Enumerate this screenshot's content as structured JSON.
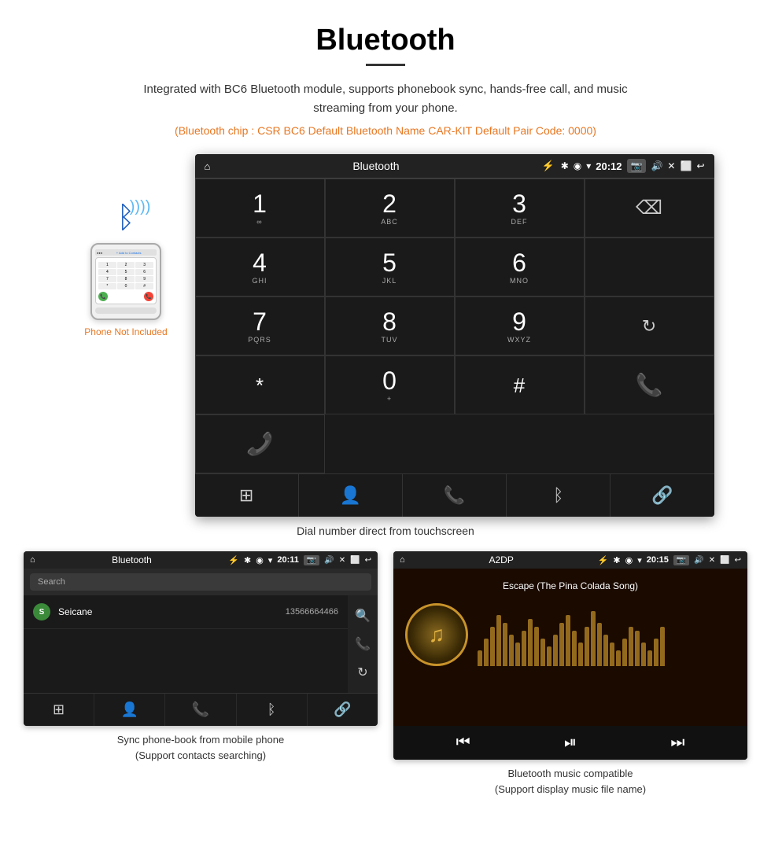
{
  "header": {
    "title": "Bluetooth",
    "subtitle": "Integrated with BC6 Bluetooth module, supports phonebook sync, hands-free call, and music streaming from your phone.",
    "orange_info": "(Bluetooth chip : CSR BC6    Default Bluetooth Name CAR-KIT    Default Pair Code: 0000)"
  },
  "phone_illustration": {
    "not_included_label": "Phone Not Included"
  },
  "main_screen": {
    "status_bar": {
      "home_icon": "⌂",
      "title": "Bluetooth",
      "usb_icon": "⚡",
      "bt_icon": "✱",
      "location_icon": "◉",
      "wifi_icon": "▾",
      "time": "20:12",
      "camera_icon": "📷",
      "volume_icon": "🔊",
      "close_icon": "✕",
      "window_icon": "⬜",
      "back_icon": "↩"
    },
    "dialpad": {
      "rows": [
        [
          {
            "num": "1",
            "letters": "∞"
          },
          {
            "num": "2",
            "letters": "ABC"
          },
          {
            "num": "3",
            "letters": "DEF"
          },
          {
            "num": "",
            "letters": "",
            "special": "backspace"
          }
        ],
        [
          {
            "num": "4",
            "letters": "GHI"
          },
          {
            "num": "5",
            "letters": "JKL"
          },
          {
            "num": "6",
            "letters": "MNO"
          },
          {
            "num": "",
            "letters": "",
            "special": "empty"
          }
        ],
        [
          {
            "num": "7",
            "letters": "PQRS"
          },
          {
            "num": "8",
            "letters": "TUV"
          },
          {
            "num": "9",
            "letters": "WXYZ"
          },
          {
            "num": "",
            "letters": "",
            "special": "reload"
          }
        ],
        [
          {
            "num": "*",
            "letters": ""
          },
          {
            "num": "0",
            "letters": "+"
          },
          {
            "num": "#",
            "letters": ""
          },
          {
            "num": "",
            "letters": "",
            "special": "call-green"
          },
          {
            "num": "",
            "letters": "",
            "special": "call-red"
          }
        ]
      ]
    },
    "bottom_nav": [
      "⊞",
      "👤",
      "📞",
      "✱",
      "🔗"
    ],
    "caption": "Dial number direct from touchscreen"
  },
  "phonebook_screen": {
    "status_bar": {
      "title": "Bluetooth",
      "time": "20:11"
    },
    "search_placeholder": "Search",
    "contacts": [
      {
        "letter": "S",
        "name": "Seicane",
        "number": "13566664466"
      }
    ],
    "caption": "Sync phone-book from mobile phone\n(Support contacts searching)"
  },
  "music_screen": {
    "status_bar": {
      "title": "A2DP",
      "time": "20:15"
    },
    "song_title": "Escape (The Pina Colada Song)",
    "eq_heights": [
      20,
      35,
      50,
      65,
      55,
      40,
      30,
      45,
      60,
      50,
      35,
      25,
      40,
      55,
      65,
      45,
      30,
      50,
      70,
      55,
      40,
      30,
      20,
      35,
      50,
      45,
      30,
      20,
      35,
      50
    ],
    "controls": [
      "⏮",
      "⏯",
      "⏭"
    ],
    "caption": "Bluetooth music compatible\n(Support display music file name)"
  }
}
